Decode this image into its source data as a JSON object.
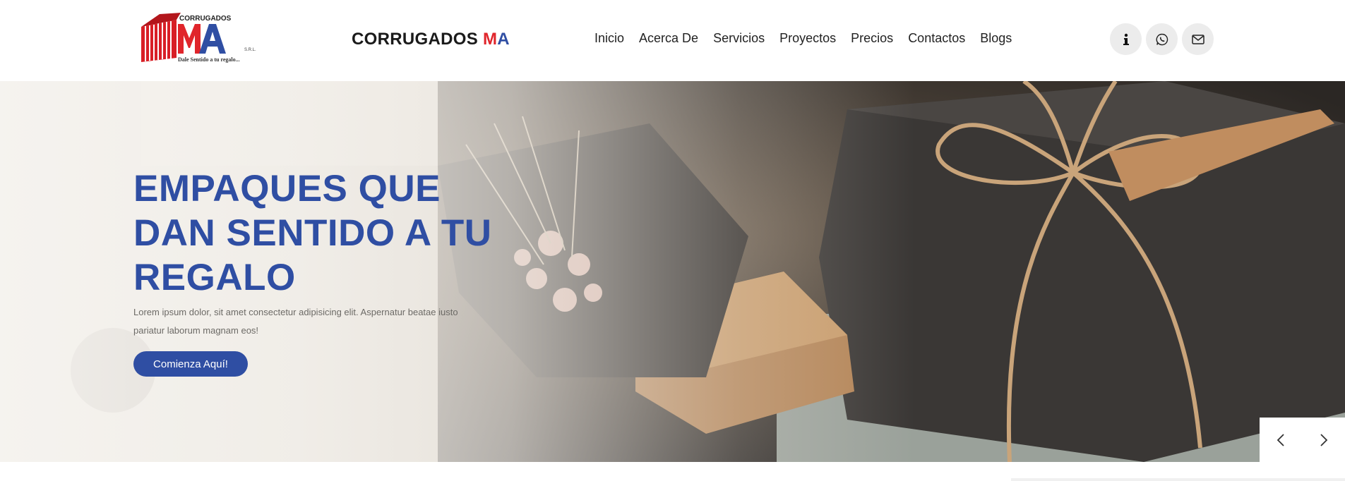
{
  "header": {
    "logo": {
      "top_text": "CORRUGADOS",
      "big_text": "MA",
      "suffix": "S.R.L.",
      "tagline": "Dale Sentido a tu regalo..."
    },
    "brand": {
      "prefix": "CORRUGADOS ",
      "m": "M",
      "a": "A"
    },
    "nav": [
      "Inicio",
      "Acerca De",
      "Servicios",
      "Proyectos",
      "Precios",
      "Contactos",
      "Blogs"
    ],
    "icons": [
      "info-icon",
      "whatsapp-icon",
      "envelope-icon"
    ]
  },
  "hero": {
    "title": "EMPAQUES QUE DAN SENTIDO A TU REGALO",
    "text": "Lorem ipsum dolor, sit amet consectetur adipisicing elit. Aspernatur beatae iusto pariatur laborum magnam eos!",
    "button": "Comienza Aquí!",
    "slider": [
      "chevron-left-icon",
      "chevron-right-icon"
    ]
  },
  "colors": {
    "accent": "#2f4ea3",
    "red": "#e0252b",
    "icon_bg": "#ececec"
  }
}
